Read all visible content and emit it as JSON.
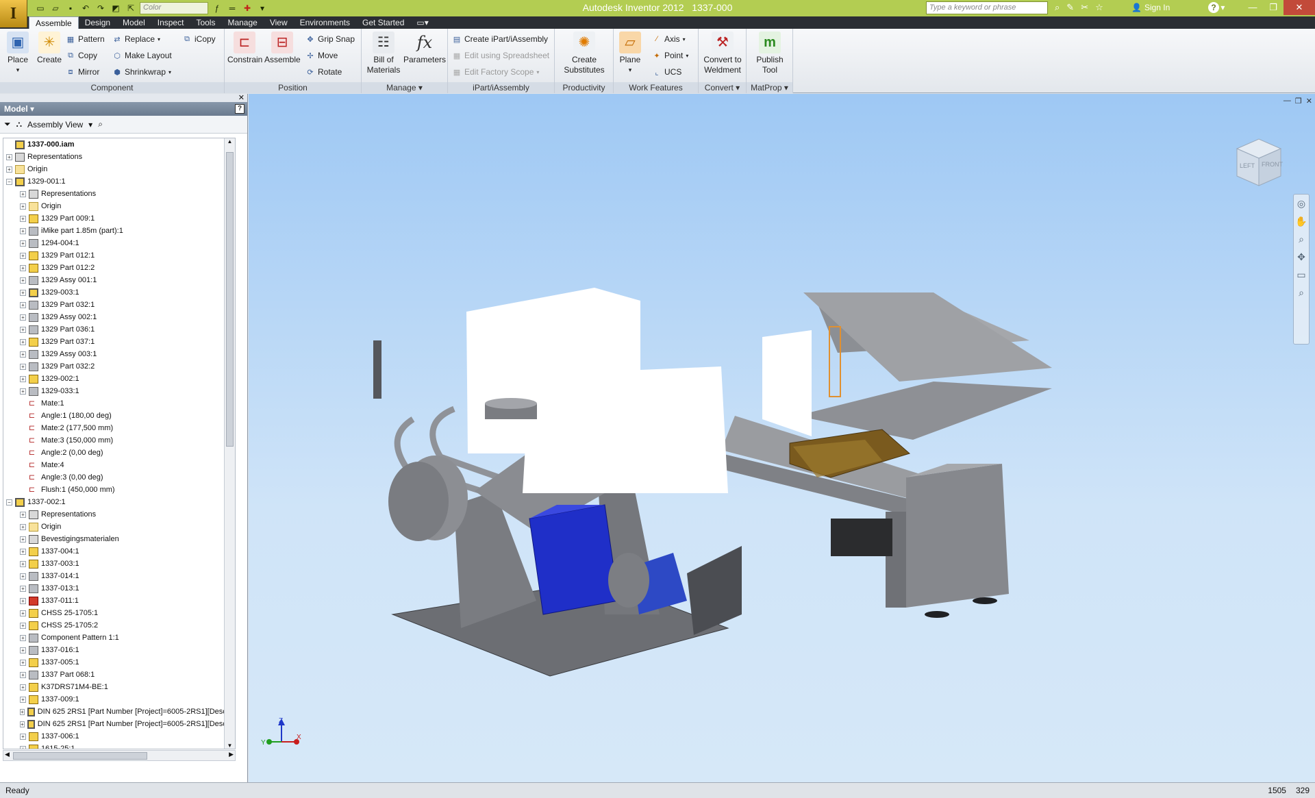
{
  "app": {
    "title": "Autodesk Inventor 2012",
    "document": "1337-000",
    "logo_letter": "I"
  },
  "qat": {
    "style_combo": "Color"
  },
  "search": {
    "placeholder": "Type a keyword or phrase"
  },
  "account": {
    "signin_label": "Sign In"
  },
  "tabs": [
    {
      "label": "Assemble",
      "active": true
    },
    {
      "label": "Design"
    },
    {
      "label": "Model"
    },
    {
      "label": "Inspect"
    },
    {
      "label": "Tools"
    },
    {
      "label": "Manage"
    },
    {
      "label": "View"
    },
    {
      "label": "Environments"
    },
    {
      "label": "Get Started"
    }
  ],
  "ribbon": {
    "component": {
      "label": "Component",
      "place": "Place",
      "create": "Create",
      "pattern": "Pattern",
      "copy": "Copy",
      "mirror": "Mirror",
      "replace": "Replace",
      "make_layout": "Make Layout",
      "shrinkwrap": "Shrinkwrap",
      "icopy": "iCopy"
    },
    "position": {
      "label": "Position",
      "constrain": "Constrain",
      "assemble": "Assemble",
      "grip_snap": "Grip Snap",
      "move": "Move",
      "rotate": "Rotate"
    },
    "manage": {
      "label": "Manage",
      "bom_line1": "Bill of",
      "bom_line2": "Materials",
      "parameters": "Parameters"
    },
    "ipart": {
      "label": "iPart/iAssembly",
      "create": "Create iPart/iAssembly",
      "edit_spreadsheet": "Edit using Spreadsheet",
      "edit_factory": "Edit Factory Scope"
    },
    "productivity": {
      "label": "Productivity",
      "line1": "Create",
      "line2": "Substitutes"
    },
    "work_features": {
      "label": "Work Features",
      "plane": "Plane",
      "axis": "Axis",
      "point": "Point",
      "ucs": "UCS"
    },
    "convert": {
      "label": "Convert",
      "line1": "Convert to",
      "line2": "Weldment"
    },
    "matprop": {
      "label": "MatProp",
      "line1": "Publish",
      "line2": "Tool"
    }
  },
  "browser": {
    "header": "Model",
    "view_mode": "Assembly View"
  },
  "tree": [
    {
      "level": 0,
      "pm": "",
      "icon": "asm",
      "label": "1337-000.iam",
      "bold": true
    },
    {
      "level": 0,
      "pm": "+",
      "icon": "rep",
      "label": "Representations"
    },
    {
      "level": 0,
      "pm": "+",
      "icon": "folder",
      "label": "Origin"
    },
    {
      "level": 0,
      "pm": "−",
      "icon": "asm",
      "label": "1329-001:1"
    },
    {
      "level": 1,
      "pm": "+",
      "icon": "rep",
      "label": "Representations"
    },
    {
      "level": 1,
      "pm": "+",
      "icon": "folder",
      "label": "Origin"
    },
    {
      "level": 1,
      "pm": "+",
      "icon": "part",
      "label": "1329 Part 009:1"
    },
    {
      "level": 1,
      "pm": "+",
      "icon": "gray",
      "label": "iMike part 1.85m (part):1"
    },
    {
      "level": 1,
      "pm": "+",
      "icon": "gray",
      "label": "1294-004:1"
    },
    {
      "level": 1,
      "pm": "+",
      "icon": "part",
      "label": "1329 Part 012:1"
    },
    {
      "level": 1,
      "pm": "+",
      "icon": "part",
      "label": "1329 Part 012:2"
    },
    {
      "level": 1,
      "pm": "+",
      "icon": "gray",
      "label": "1329 Assy 001:1"
    },
    {
      "level": 1,
      "pm": "+",
      "icon": "asm",
      "label": "1329-003:1"
    },
    {
      "level": 1,
      "pm": "+",
      "icon": "gray",
      "label": "1329 Part 032:1"
    },
    {
      "level": 1,
      "pm": "+",
      "icon": "gray",
      "label": "1329 Assy 002:1"
    },
    {
      "level": 1,
      "pm": "+",
      "icon": "gray",
      "label": "1329 Part 036:1"
    },
    {
      "level": 1,
      "pm": "+",
      "icon": "part",
      "label": "1329 Part 037:1"
    },
    {
      "level": 1,
      "pm": "+",
      "icon": "gray",
      "label": "1329 Assy 003:1"
    },
    {
      "level": 1,
      "pm": "+",
      "icon": "gray",
      "label": "1329 Part 032:2"
    },
    {
      "level": 1,
      "pm": "+",
      "icon": "part",
      "label": "1329-002:1"
    },
    {
      "level": 1,
      "pm": "+",
      "icon": "gray",
      "label": "1329-033:1"
    },
    {
      "level": 1,
      "pm": "",
      "icon": "con",
      "label": "Mate:1"
    },
    {
      "level": 1,
      "pm": "",
      "icon": "con",
      "label": "Angle:1 (180,00 deg)"
    },
    {
      "level": 1,
      "pm": "",
      "icon": "con",
      "label": "Mate:2 (177,500 mm)"
    },
    {
      "level": 1,
      "pm": "",
      "icon": "con",
      "label": "Mate:3 (150,000 mm)"
    },
    {
      "level": 1,
      "pm": "",
      "icon": "con",
      "label": "Angle:2 (0,00 deg)"
    },
    {
      "level": 1,
      "pm": "",
      "icon": "con",
      "label": "Mate:4"
    },
    {
      "level": 1,
      "pm": "",
      "icon": "con",
      "label": "Angle:3 (0,00 deg)"
    },
    {
      "level": 1,
      "pm": "",
      "icon": "con",
      "label": "Flush:1 (450,000 mm)"
    },
    {
      "level": 0,
      "pm": "−",
      "icon": "asm",
      "label": "1337-002:1"
    },
    {
      "level": 1,
      "pm": "+",
      "icon": "rep",
      "label": "Representations"
    },
    {
      "level": 1,
      "pm": "+",
      "icon": "folder",
      "label": "Origin"
    },
    {
      "level": 1,
      "pm": "+",
      "icon": "rep",
      "label": "Bevestigingsmaterialen"
    },
    {
      "level": 1,
      "pm": "+",
      "icon": "part",
      "label": "1337-004:1"
    },
    {
      "level": 1,
      "pm": "+",
      "icon": "part",
      "label": "1337-003:1"
    },
    {
      "level": 1,
      "pm": "+",
      "icon": "gray",
      "label": "1337-014:1"
    },
    {
      "level": 1,
      "pm": "+",
      "icon": "gray",
      "label": "1337-013:1"
    },
    {
      "level": 1,
      "pm": "+",
      "icon": "red",
      "label": "1337-011:1"
    },
    {
      "level": 1,
      "pm": "+",
      "icon": "part",
      "label": "CHSS 25-1705:1"
    },
    {
      "level": 1,
      "pm": "+",
      "icon": "part",
      "label": "CHSS 25-1705:2"
    },
    {
      "level": 1,
      "pm": "+",
      "icon": "gray",
      "label": "Component Pattern 1:1"
    },
    {
      "level": 1,
      "pm": "+",
      "icon": "gray",
      "label": "1337-016:1"
    },
    {
      "level": 1,
      "pm": "+",
      "icon": "part",
      "label": "1337-005:1"
    },
    {
      "level": 1,
      "pm": "+",
      "icon": "gray",
      "label": "1337 Part 068:1"
    },
    {
      "level": 1,
      "pm": "+",
      "icon": "part",
      "label": "K37DRS71M4-BE:1"
    },
    {
      "level": 1,
      "pm": "+",
      "icon": "part",
      "label": "1337-009:1"
    },
    {
      "level": 1,
      "pm": "+",
      "icon": "asm",
      "label": "DIN 625 2RS1 [Part Number [Project]=6005-2RS1][Descrip"
    },
    {
      "level": 1,
      "pm": "+",
      "icon": "asm",
      "label": "DIN 625 2RS1 [Part Number [Project]=6005-2RS1][Descrip"
    },
    {
      "level": 1,
      "pm": "+",
      "icon": "part",
      "label": "1337-006:1"
    },
    {
      "level": 1,
      "pm": "+",
      "icon": "part",
      "label": "1615-25:1"
    }
  ],
  "viewcube": {
    "left": "LEFT",
    "front": "FRONT"
  },
  "triad": {
    "x": "X",
    "y": "Y",
    "z": "Z"
  },
  "status": {
    "text": "Ready",
    "coord1": "1505",
    "coord2": "329"
  },
  "colors": {
    "titlebar": "#b3cd52",
    "tabbar": "#2b2e33",
    "motor_blue": "#1f2fc8",
    "frame_gray": "#7d7f84"
  }
}
